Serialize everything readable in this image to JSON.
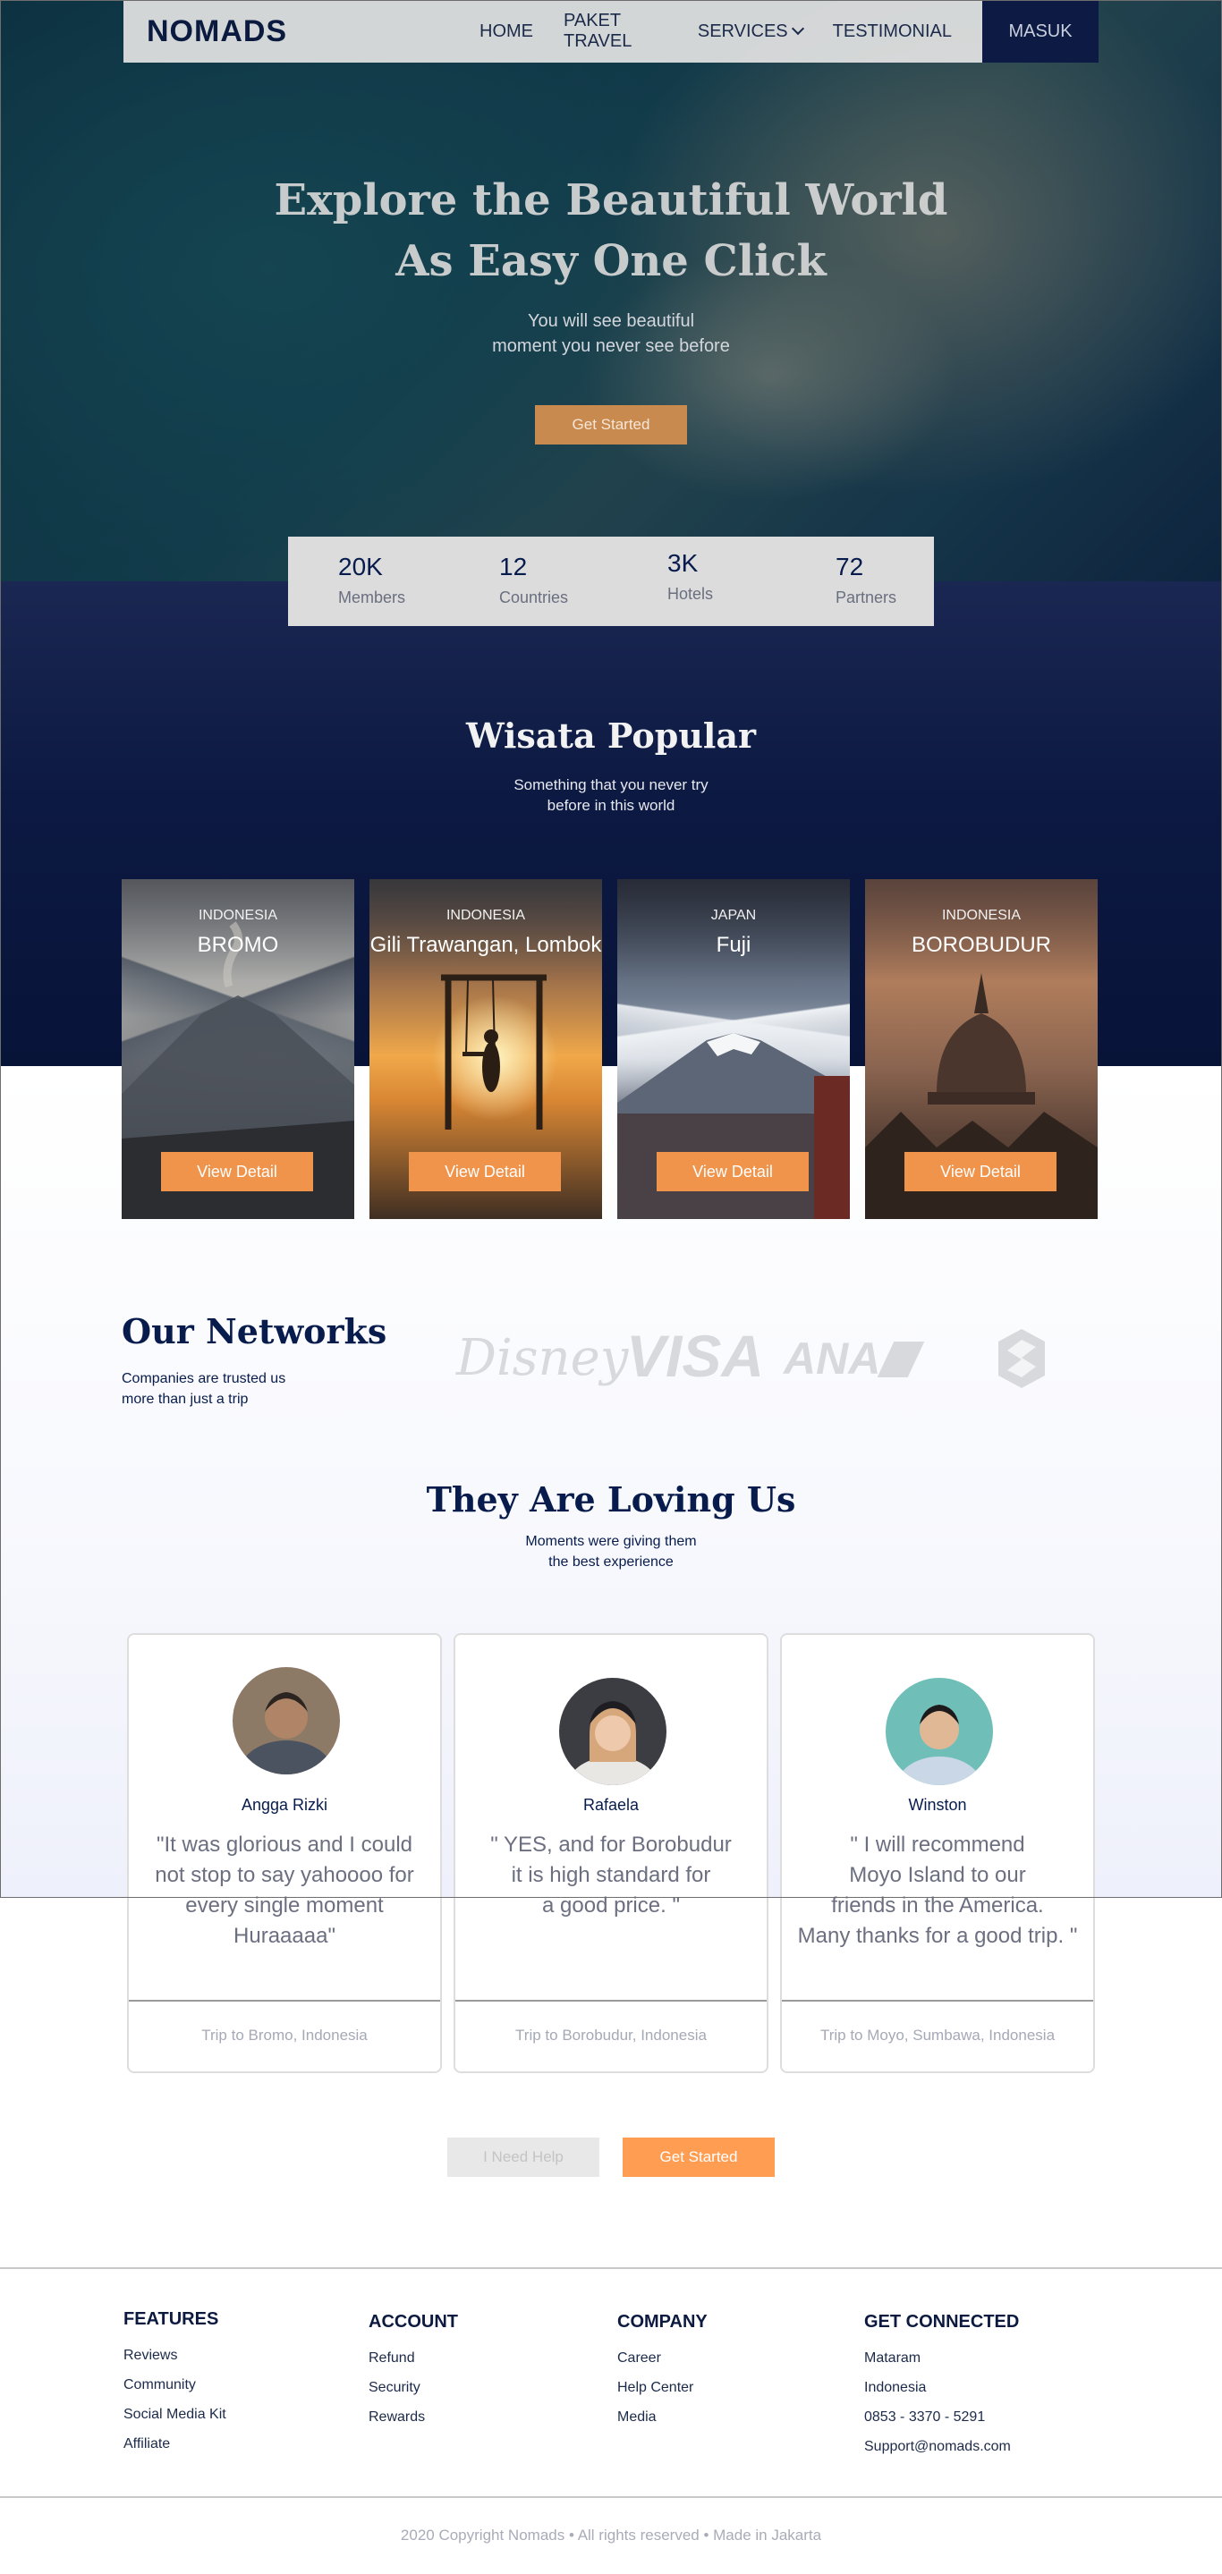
{
  "nav": {
    "logo": "NOMADS",
    "links": [
      "HOME",
      "PAKET TRAVEL",
      "SERVICES",
      "TESTIMONIAL"
    ],
    "login_label": "MASUK"
  },
  "hero": {
    "title_line1": "Explore the Beautiful World",
    "title_line2": "As Easy One Click",
    "subtitle_line1": "You will see beautiful",
    "subtitle_line2": "moment you never see before",
    "cta_label": "Get Started"
  },
  "stats": [
    {
      "value": "20K",
      "label": "Members"
    },
    {
      "value": "12",
      "label": "Countries"
    },
    {
      "value": "3K",
      "label": "Hotels"
    },
    {
      "value": "72",
      "label": "Partners"
    }
  ],
  "popular": {
    "title": "Wisata Popular",
    "subtitle_line1": "Something that you never try",
    "subtitle_line2": "before in this world",
    "cards": [
      {
        "country": "INDONESIA",
        "name": "BROMO",
        "button": "View Detail"
      },
      {
        "country": "INDONESIA",
        "name": "Gili Trawangan, Lombok",
        "button": "View Detail"
      },
      {
        "country": "JAPAN",
        "name": "Fuji",
        "button": "View Detail"
      },
      {
        "country": "INDONESIA",
        "name": "BOROBUDUR",
        "button": "View Detail"
      }
    ]
  },
  "networks": {
    "title": "Our Networks",
    "subtitle_line1": "Companies are trusted us",
    "subtitle_line2": "more than just a trip",
    "partners": [
      "Disney",
      "VISA",
      "ANA"
    ],
    "partner_icons": [
      "disney-logo",
      "visa-logo",
      "ana-logo",
      "shield-logo-icon"
    ]
  },
  "testimonials": {
    "title": "They Are Loving Us",
    "subtitle_line1": "Moments were giving them",
    "subtitle_line2": "the best experience",
    "items": [
      {
        "name": "Angga Rizki",
        "quote": "\"It was glorious and I could\nnot stop to say yahoooo for\nevery single moment\nHuraaaaa\"",
        "trip": "Trip to Bromo,  Indonesia"
      },
      {
        "name": "Rafaela",
        "quote": "\" YES, and for Borobudur\nit is high standard for\na good price. \"",
        "trip": "Trip to Borobudur, Indonesia"
      },
      {
        "name": "Winston",
        "quote": "\" I will recommend\nMoyo Island to our\nfriends in the America.\nMany thanks for a good trip. \"",
        "trip": "Trip to Moyo, Sumbawa, Indonesia"
      }
    ]
  },
  "actions": {
    "help_label": "I Need Help",
    "start_label": "Get Started"
  },
  "footer": {
    "columns": [
      {
        "title": "FEATURES",
        "links": [
          "Reviews",
          "Community",
          "Social Media Kit",
          "Affiliate"
        ]
      },
      {
        "title": "ACCOUNT",
        "links": [
          "Refund",
          "Security",
          "Rewards"
        ]
      },
      {
        "title": "COMPANY",
        "links": [
          "Career",
          "Help Center",
          "Media"
        ]
      },
      {
        "title": "GET CONNECTED",
        "links": [
          "Mataram",
          "Indonesia",
          "0853 - 3370 - 5291",
          "Support@nomads.com"
        ]
      }
    ],
    "copyright": "2020 Copyright Nomads • All rights reserved • Made in Jakarta"
  },
  "colors": {
    "navy": "#0c1942",
    "accent_orange": "#f0944c",
    "cta_orange": "#ff9e53",
    "text_dark": "#071c4d"
  }
}
